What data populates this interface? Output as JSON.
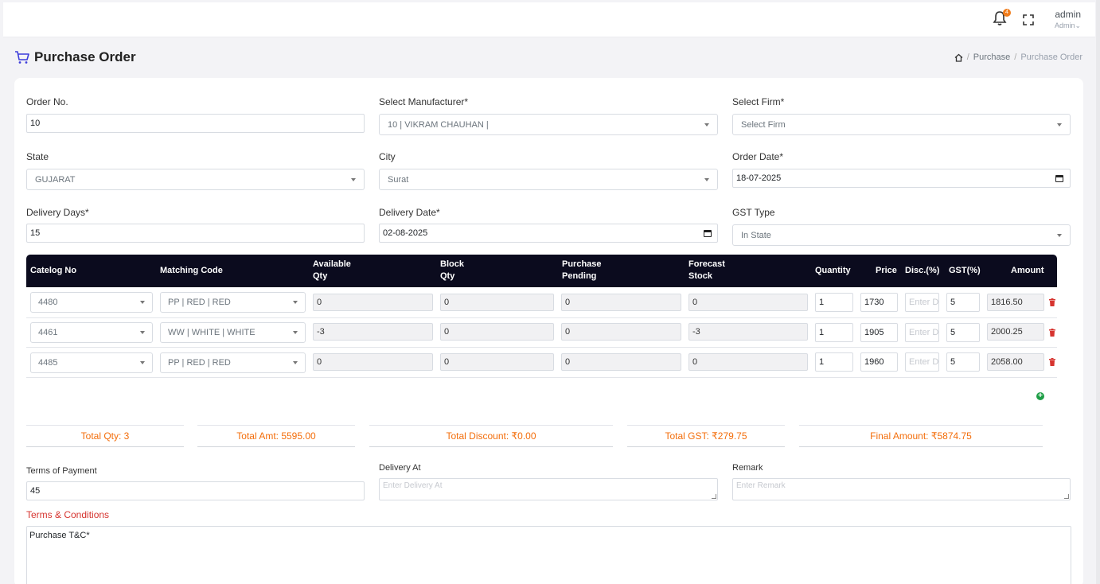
{
  "header": {
    "notification_count": "4",
    "user_name": "admin",
    "user_role": "Admin"
  },
  "page": {
    "title": "Purchase Order"
  },
  "breadcrumb": {
    "items": [
      "Purchase",
      "Purchase Order"
    ]
  },
  "form": {
    "order_no": {
      "label": "Order No.",
      "value": "10"
    },
    "manufacturer": {
      "label": "Select Manufacturer*",
      "value": "10 | VIKRAM CHAUHAN |"
    },
    "firm": {
      "label": "Select Firm*",
      "value": "Select Firm"
    },
    "state": {
      "label": "State",
      "value": "GUJARAT"
    },
    "city": {
      "label": "City",
      "value": "Surat"
    },
    "order_date": {
      "label": "Order Date*",
      "value": "18-07-2025"
    },
    "delivery_days": {
      "label": "Delivery Days*",
      "value": "15"
    },
    "delivery_date": {
      "label": "Delivery Date*",
      "value": "02-08-2025"
    },
    "gst_type": {
      "label": "GST Type",
      "value": "In State"
    }
  },
  "table": {
    "headers": {
      "catalog": "Catelog No",
      "matching": "Matching Code",
      "available_1": "Available",
      "available_2": "Qty",
      "block_1": "Block",
      "block_2": "Qty",
      "purchase_1": "Purchase",
      "purchase_2": "Pending",
      "forecast_1": "Forecast",
      "forecast_2": "Stock",
      "quantity": "Quantity",
      "price": "Price",
      "disc": "Disc.(%)",
      "gst": "GST(%)",
      "amount": "Amount"
    },
    "disc_placeholder": "Enter D",
    "rows": [
      {
        "catalog": "4480",
        "matching": "PP | RED | RED",
        "available": "0",
        "block": "0",
        "purchase_pending": "0",
        "forecast": "0",
        "quantity": "1",
        "price": "1730",
        "gst": "5",
        "amount": "1816.50"
      },
      {
        "catalog": "4461",
        "matching": "WW | WHITE | WHITE",
        "available": "-3",
        "block": "0",
        "purchase_pending": "0",
        "forecast": "-3",
        "quantity": "1",
        "price": "1905",
        "gst": "5",
        "amount": "2000.25"
      },
      {
        "catalog": "4485",
        "matching": "PP | RED | RED",
        "available": "0",
        "block": "0",
        "purchase_pending": "0",
        "forecast": "0",
        "quantity": "1",
        "price": "1960",
        "gst": "5",
        "amount": "2058.00"
      }
    ]
  },
  "totals": {
    "qty": "Total Qty: 3",
    "amt": "Total Amt: 5595.00",
    "discount": "Total Discount: ₹0.00",
    "gst": "Total GST: ₹279.75",
    "final": "Final Amount: ₹5874.75"
  },
  "footer_form": {
    "terms_of_payment": {
      "label": "Terms of Payment",
      "value": "45"
    },
    "delivery_at": {
      "label": "Delivery At",
      "placeholder": "Enter Delivery At"
    },
    "remark": {
      "label": "Remark",
      "placeholder": "Enter Remark"
    }
  },
  "terms": {
    "title": "Terms & Conditions",
    "value": "Purchase T&C*"
  },
  "colors": {
    "accent": "#f36d0a",
    "header_bg": "#0b0b1e",
    "danger": "#d6342f",
    "add": "#1e9e46"
  }
}
